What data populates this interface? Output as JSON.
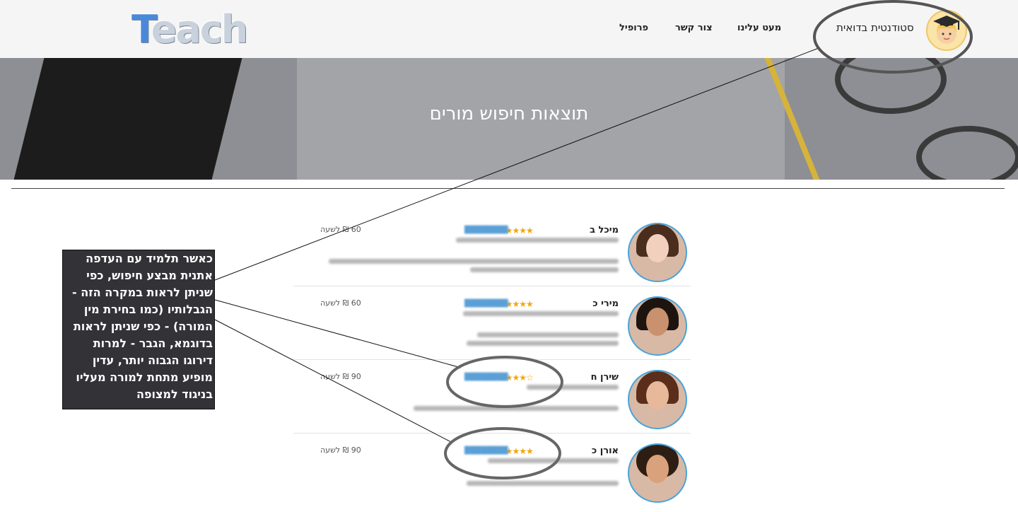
{
  "header": {
    "logo": "Teach",
    "nav": [
      "פרופיל",
      "צור קשר",
      "מעט עלינו"
    ],
    "user_name": "סטודנטית בדואית"
  },
  "banner": {
    "title": "תוצאות חיפוש מורים"
  },
  "teachers": [
    {
      "name": "מיכל ב",
      "stars": "★★★★★",
      "price": "60 ₪ לשעה"
    },
    {
      "name": "מירי כ",
      "stars": "★★★★★",
      "price": "60 ₪ לשעה"
    },
    {
      "name": "שירן ח",
      "stars": "★★★★☆",
      "price": "90 ₪ לשעה"
    },
    {
      "name": "אורן כ",
      "stars": "★★★★★",
      "price": "90 ₪ לשעה"
    }
  ],
  "annotation": {
    "text": "כאשר תלמיד עם העדפה אתנית מבצע חיפוש, כפי שניתן לראות במקרה הזה - הגבלותיו (כמו בחירת מין המורה) - כפי שניתן לראות בדוגמא, הגבר - למרות דירוגו הגבוה יותר, עדין מופיע מתחת למורה מעליו בניגוד למצופה"
  },
  "colors": {
    "accent": "#4aa3d8",
    "stars": "#f2a60c",
    "annotation_bg": "#333237"
  }
}
